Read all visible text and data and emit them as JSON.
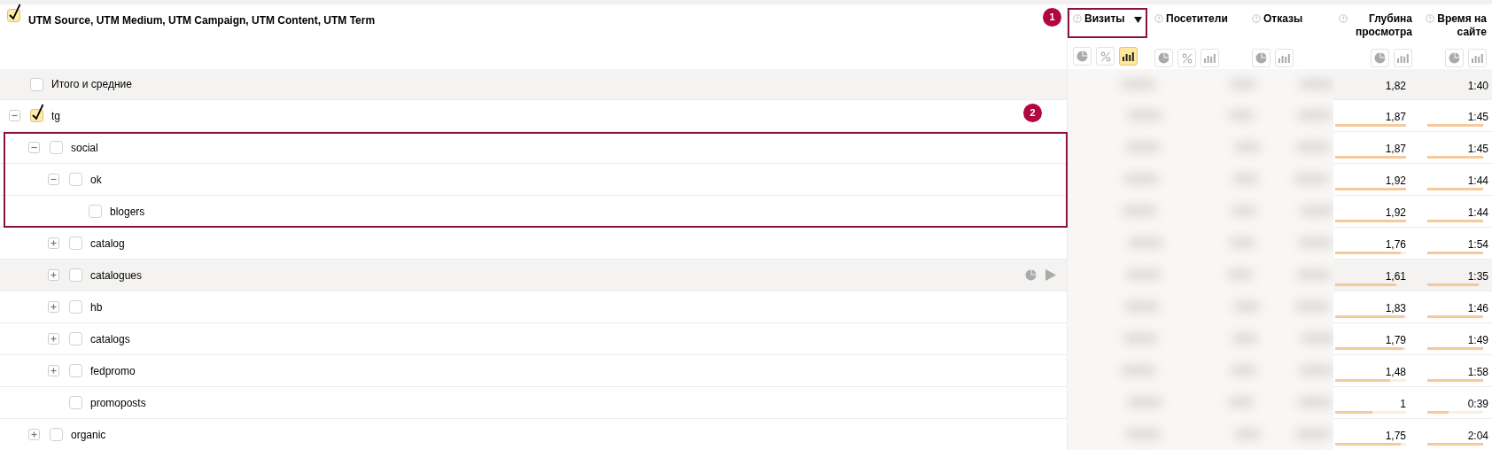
{
  "header": {
    "title": "UTM Source, UTM Medium, UTM Campaign, UTM Content, UTM Term",
    "checked": true,
    "badge": "1"
  },
  "columns": [
    {
      "label": "Визиты",
      "selected": true,
      "framed": true,
      "views": [
        {
          "kind": "pie",
          "selected": false
        },
        {
          "kind": "percent",
          "selected": false
        },
        {
          "kind": "bars",
          "selected": true
        }
      ]
    },
    {
      "label": "Посетители",
      "selected": false,
      "framed": false,
      "views": [
        {
          "kind": "pie",
          "selected": false
        },
        {
          "kind": "percent",
          "selected": false
        },
        {
          "kind": "bars",
          "selected": false
        }
      ]
    },
    {
      "label": "Отказы",
      "selected": false,
      "framed": false,
      "views": [
        {
          "kind": "pie",
          "selected": false
        },
        {
          "kind": "bars",
          "selected": false
        }
      ]
    },
    {
      "label": "Глубина просмотра",
      "selected": false,
      "framed": false,
      "views": [
        {
          "kind": "pie",
          "selected": false
        },
        {
          "kind": "bars",
          "selected": false
        }
      ]
    },
    {
      "label": "Время на сайте",
      "selected": false,
      "framed": false,
      "views": [
        {
          "kind": "pie",
          "selected": false
        },
        {
          "kind": "bars",
          "selected": false
        }
      ]
    }
  ],
  "total": {
    "label": "Итого и средние",
    "checked": false,
    "depth": "1,82",
    "time": "1:40"
  },
  "rows": [
    {
      "label": "tg",
      "checked": true,
      "expanded": true,
      "badge": "2",
      "depth": "1,87",
      "depth_level": {
        "level": 1
      },
      "time": "1:45",
      "time_level": {
        "level": 1
      },
      "children": [
        {
          "label": "social",
          "checked": false,
          "expanded": true,
          "framed": true,
          "depth": "1,87",
          "depth_level": {
            "level": 1
          },
          "time": "1:45",
          "time_level": {
            "level": 1
          },
          "children": [
            {
              "label": "ok",
              "checked": false,
              "expanded": true,
              "framed": true,
              "depth": "1,92",
              "depth_level": {
                "level": 1
              },
              "time": "1:44",
              "time_level": {
                "level": 1
              },
              "children": [
                {
                  "label": "blogers",
                  "checked": false,
                  "framed": true,
                  "depth": "1,92",
                  "depth_level": {
                    "level": 1
                  },
                  "time": "1:44",
                  "time_level": {
                    "level": 1
                  }
                }
              ]
            },
            {
              "label": "catalog",
              "checked": false,
              "expanded": false,
              "depth": "1,76",
              "depth_level": {
                "level": 0.93
              },
              "time": "1:54",
              "time_level": {
                "level": 1
              }
            },
            {
              "label": "catalogues",
              "checked": false,
              "expanded": false,
              "hovered": true,
              "depth": "1,61",
              "depth_level": {
                "level": 0.86
              },
              "time": "1:35",
              "time_level": {
                "level": 0.92
              }
            },
            {
              "label": "hb",
              "checked": false,
              "expanded": false,
              "depth": "1,83",
              "depth_level": {
                "level": 0.97
              },
              "time": "1:46",
              "time_level": {
                "level": 1
              }
            },
            {
              "label": "catalogs",
              "checked": false,
              "expanded": false,
              "depth": "1,79",
              "depth_level": {
                "level": 0.96
              },
              "time": "1:49",
              "time_level": {
                "level": 1
              }
            },
            {
              "label": "fedpromo",
              "checked": false,
              "expanded": false,
              "depth": "1,48",
              "depth_level": {
                "level": 0.78
              },
              "time": "1:58",
              "time_level": {
                "level": 1
              }
            },
            {
              "label": "promoposts",
              "checked": false,
              "depth": "1",
              "depth_level": {
                "level": 0.53
              },
              "time": "0:39",
              "time_level": {
                "level": 0.38
              }
            }
          ]
        },
        {
          "label": "organic",
          "checked": false,
          "expanded": false,
          "depth": "1,75",
          "depth_level": {
            "level": 0.93
          },
          "time": "2:04",
          "time_level": {
            "level": 1
          }
        }
      ]
    }
  ]
}
